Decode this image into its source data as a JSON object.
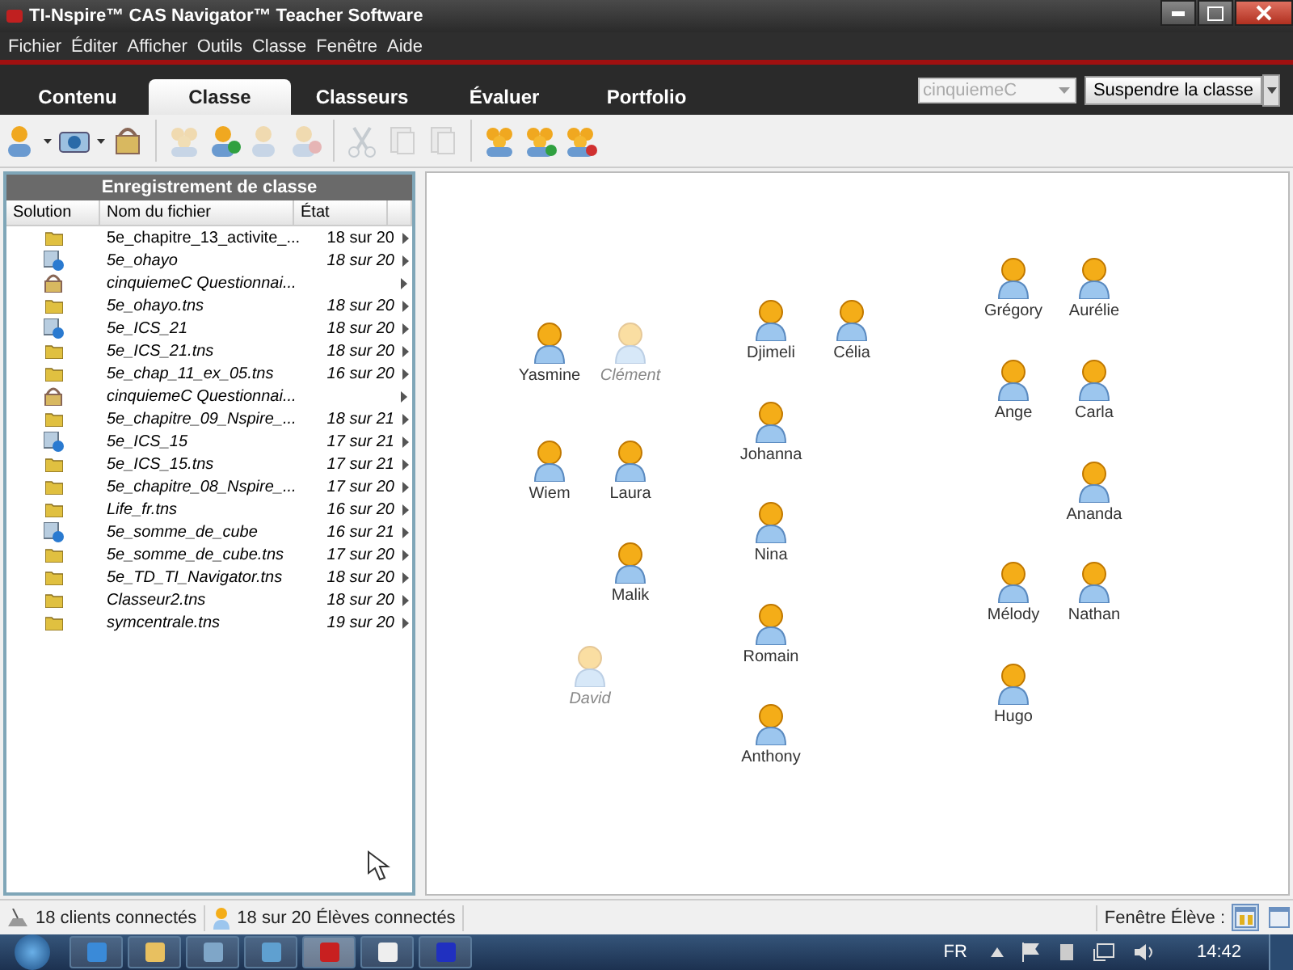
{
  "window": {
    "title": "TI-Nspire™ CAS Navigator™ Teacher Software"
  },
  "menu": [
    "Fichier",
    "Éditer",
    "Afficher",
    "Outils",
    "Classe",
    "Fenêtre",
    "Aide"
  ],
  "tabs": [
    {
      "label": "Contenu",
      "selected": false
    },
    {
      "label": "Classe",
      "selected": true
    },
    {
      "label": "Classeurs",
      "selected": false
    },
    {
      "label": "Évaluer",
      "selected": false
    },
    {
      "label": "Portfolio",
      "selected": false
    }
  ],
  "class_select": {
    "value": "cinquiemeC",
    "disabled": true
  },
  "suspend_button": "Suspendre la classe",
  "toolbar": [
    {
      "kind": "user",
      "disabled": false,
      "caret": true
    },
    {
      "kind": "camera",
      "disabled": false,
      "caret": true
    },
    {
      "kind": "quiz",
      "disabled": false,
      "caret": false
    },
    {
      "kind": "group",
      "disabled": true,
      "caret": false
    },
    {
      "kind": "user-add",
      "disabled": false,
      "caret": false
    },
    {
      "kind": "user",
      "disabled": true,
      "caret": false
    },
    {
      "kind": "user-remove",
      "disabled": true,
      "caret": false
    },
    {
      "kind": "cut",
      "disabled": true,
      "caret": false
    },
    {
      "kind": "copy",
      "disabled": true,
      "caret": false
    },
    {
      "kind": "paste",
      "disabled": true,
      "caret": false
    },
    {
      "kind": "group",
      "disabled": false,
      "caret": false
    },
    {
      "kind": "group-send",
      "disabled": false,
      "caret": false
    },
    {
      "kind": "group-remove",
      "disabled": false,
      "caret": false
    }
  ],
  "record": {
    "title": "Enregistrement de classe",
    "columns": [
      "Solution",
      "Nom du fichier",
      "État"
    ],
    "rows": [
      {
        "kind": "file",
        "name": "5e_chapitre_13_activite_...",
        "state": "18 sur 20",
        "current": true
      },
      {
        "kind": "live",
        "name": "5e_ohayo",
        "state": "18 sur 20",
        "current": false
      },
      {
        "kind": "quiz",
        "name": "cinquiemeC Questionnai...",
        "current": false
      },
      {
        "kind": "file",
        "name": "5e_ohayo.tns",
        "state": "18 sur 20",
        "current": false
      },
      {
        "kind": "live",
        "name": "5e_ICS_21",
        "state": "18 sur 20",
        "current": false
      },
      {
        "kind": "file",
        "name": "5e_ICS_21.tns",
        "state": "18 sur 20",
        "current": false
      },
      {
        "kind": "file",
        "name": "5e_chap_11_ex_05.tns",
        "state": "16 sur 20",
        "current": false
      },
      {
        "kind": "quiz",
        "name": "cinquiemeC Questionnai...",
        "current": false
      },
      {
        "kind": "file",
        "name": "5e_chapitre_09_Nspire_...",
        "state": "18 sur 21",
        "current": false
      },
      {
        "kind": "live",
        "name": "5e_ICS_15",
        "state": "17 sur 21",
        "current": false
      },
      {
        "kind": "file",
        "name": "5e_ICS_15.tns",
        "state": "17 sur 21",
        "current": false
      },
      {
        "kind": "file",
        "name": "5e_chapitre_08_Nspire_...",
        "state": "17 sur 20",
        "current": false
      },
      {
        "kind": "file",
        "name": "Life_fr.tns",
        "state": "16 sur 20",
        "current": false
      },
      {
        "kind": "live",
        "name": "5e_somme_de_cube",
        "state": "16 sur 21",
        "current": false
      },
      {
        "kind": "file",
        "name": "5e_somme_de_cube.tns",
        "state": "17 sur 20",
        "current": false
      },
      {
        "kind": "file",
        "name": "5e_TD_TI_Navigator.tns",
        "state": "18 sur 20",
        "current": false
      },
      {
        "kind": "file",
        "name": "Classeur2.tns",
        "state": "18 sur 20",
        "current": false
      },
      {
        "kind": "file",
        "name": "symcentrale.tns",
        "state": "19 sur 20",
        "current": false
      }
    ]
  },
  "students": [
    {
      "name": "Yasmine",
      "connected": true
    },
    {
      "name": "Clément",
      "connected": false
    },
    {
      "name": "Wiem",
      "connected": true
    },
    {
      "name": "Laura",
      "connected": true
    },
    {
      "name": "Malik",
      "connected": true
    },
    {
      "name": "David",
      "connected": false
    },
    {
      "name": "Djimeli",
      "connected": true
    },
    {
      "name": "Johanna",
      "connected": true
    },
    {
      "name": "Nina",
      "connected": true
    },
    {
      "name": "Romain",
      "connected": true
    },
    {
      "name": "Anthony",
      "connected": true
    },
    {
      "name": "Célia",
      "connected": true
    },
    {
      "name": "Grégory",
      "connected": true
    },
    {
      "name": "Ange",
      "connected": true
    },
    {
      "name": "Mélody",
      "connected": true
    },
    {
      "name": "Hugo",
      "connected": true
    },
    {
      "name": "Aurélie",
      "connected": true
    },
    {
      "name": "Carla",
      "connected": true
    },
    {
      "name": "Ananda",
      "connected": true
    },
    {
      "name": "Nathan",
      "connected": true
    }
  ],
  "status_bar": {
    "clients": "18 clients connectés",
    "students": "18 sur 20 Élèves connectés",
    "view_label": "Fenêtre Élève :",
    "views": [
      {
        "kind": "grid",
        "selected": true
      },
      {
        "kind": "list",
        "selected": false
      }
    ]
  },
  "taskbar": {
    "apps": [
      {
        "kind": "ie",
        "selected": false
      },
      {
        "kind": "explorer",
        "selected": false
      },
      {
        "kind": "network",
        "selected": false
      },
      {
        "kind": "monitor",
        "selected": false
      },
      {
        "kind": "nspire",
        "selected": true
      },
      {
        "kind": "doc",
        "selected": false
      },
      {
        "kind": "window",
        "selected": false
      }
    ],
    "language": "FR",
    "clock": "14:42"
  }
}
